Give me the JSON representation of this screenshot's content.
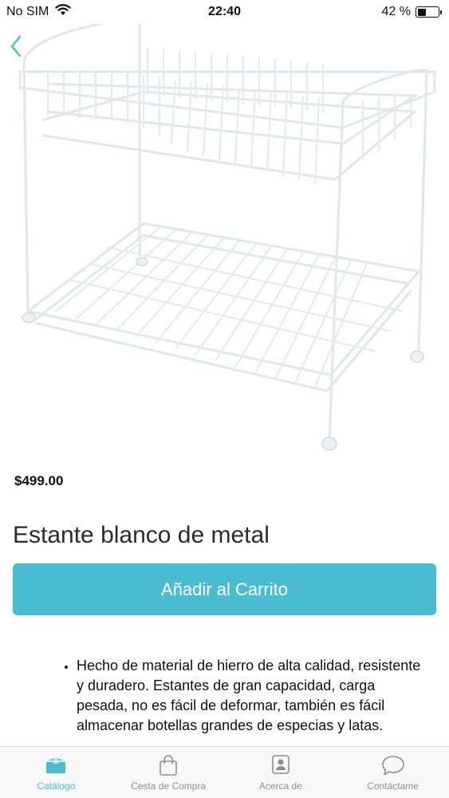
{
  "status_bar": {
    "carrier": "No SIM",
    "time": "22:40",
    "battery": "42 %",
    "battery_level": 0.42
  },
  "product": {
    "image_icon": "white-metal-wire-shelf-image",
    "price": "$499.00",
    "title": "Estante blanco de metal",
    "add_to_cart_label": "Añadir al Carrito",
    "description_items": [
      "Hecho de material de hierro de alta calidad, resistente y duradero. Estantes de gran capacidad, carga pesada, no es fácil de deformar, también es fácil almacenar botellas grandes de especias y latas."
    ]
  },
  "tab_bar": {
    "items": [
      {
        "label": "Catálogo",
        "icon": "catalog-box-icon",
        "active": true
      },
      {
        "label": "Cesta de Compra",
        "icon": "shopping-bag-icon",
        "active": false
      },
      {
        "label": "Acerca de",
        "icon": "about-badge-icon",
        "active": false
      },
      {
        "label": "Contáctame",
        "icon": "chat-bubble-icon",
        "active": false
      }
    ]
  },
  "colors": {
    "accent": "#4bbdd3",
    "inactive": "#8e8e93"
  }
}
